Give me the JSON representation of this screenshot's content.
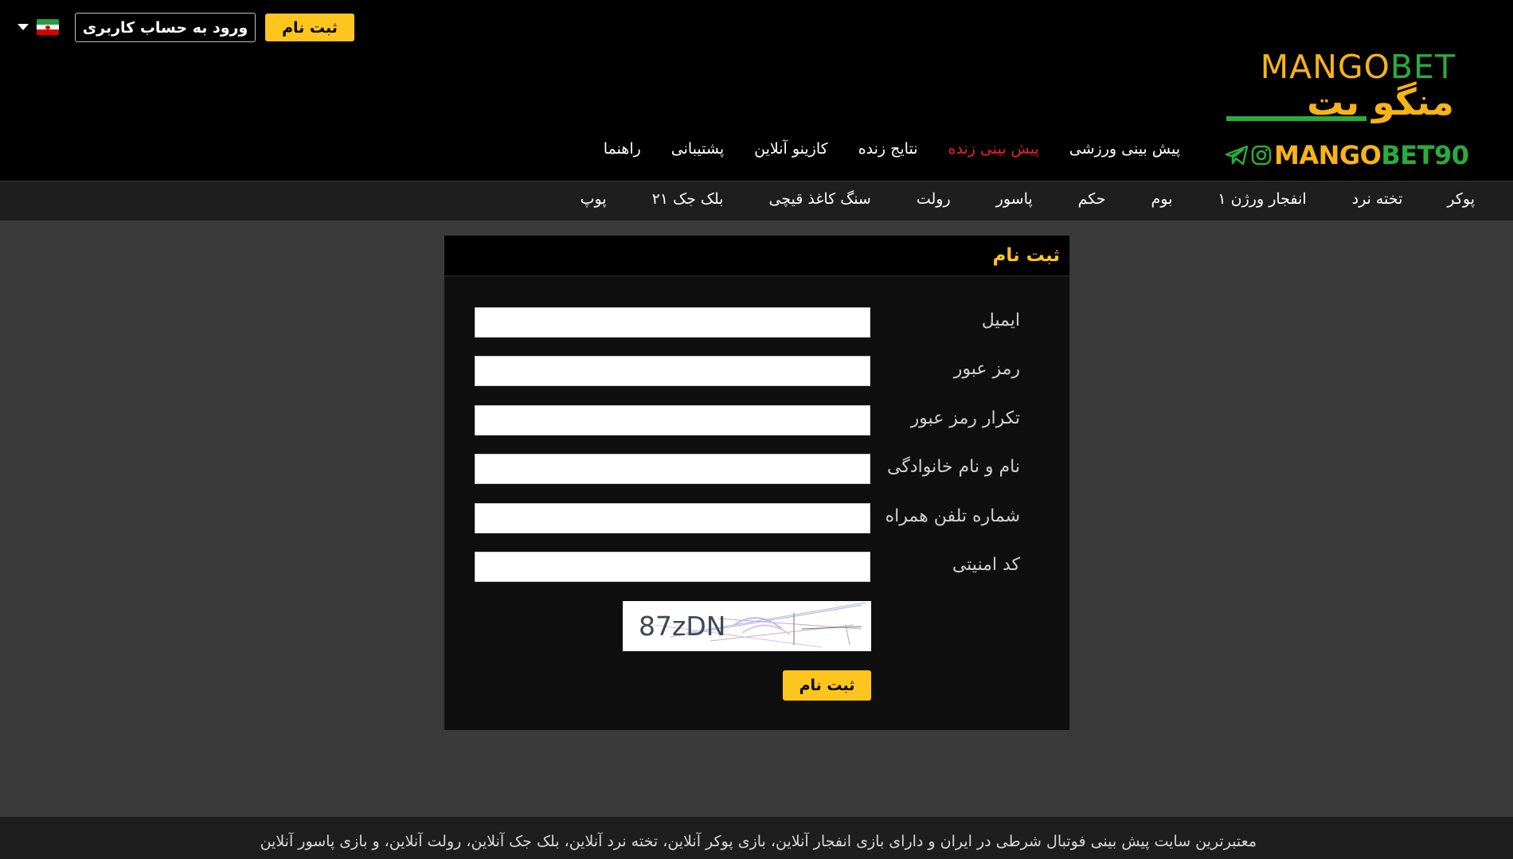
{
  "header": {
    "register_label": "ثبت نام",
    "login_label": "ورود به حساب کاربری",
    "language_flag": "iran-flag-icon",
    "logo": {
      "en_part1": "MANGO",
      "en_part2": "BET",
      "fa": "منگو بت",
      "handle_part1": "MANGO",
      "handle_part2": "BET90"
    }
  },
  "main_nav": {
    "items": [
      {
        "label": "پیش بینی ورزشی",
        "active": false
      },
      {
        "label": "پیش بینی زنده",
        "active": true
      },
      {
        "label": "نتایج زنده",
        "active": false
      },
      {
        "label": "کازینو آنلاین",
        "active": false
      },
      {
        "label": "پشتیبانی",
        "active": false
      },
      {
        "label": "راهنما",
        "active": false
      }
    ]
  },
  "sub_nav": {
    "items": [
      "پوکر",
      "تخته نرد",
      "انفجار ورژن ۱",
      "بوم",
      "حکم",
      "پاسور",
      "رولت",
      "سنگ کاغذ قیچی",
      "بلک جک ۲۱",
      "پوپ"
    ]
  },
  "form": {
    "title": "ثبت نام",
    "fields": [
      {
        "label": "ایمیل",
        "value": ""
      },
      {
        "label": "رمز عبور",
        "value": ""
      },
      {
        "label": "تکرار رمز عبور",
        "value": ""
      },
      {
        "label": "نام و نام خانوادگی",
        "value": ""
      },
      {
        "label": "شماره تلفن همراه",
        "value": ""
      },
      {
        "label": "کد امنیتی",
        "value": ""
      }
    ],
    "captcha_text": "87zDN",
    "submit_label": "ثبت نام"
  },
  "footer": {
    "text": "معتبرترین سایت پیش بینی فوتبال شرطی در ایران و دارای بازی انفجار آنلاین، بازی پوکر آنلاین، تخته نرد آنلاین، بلک جک آنلاین، رولت آنلاین، و بازی پاسور آنلاین"
  },
  "colors": {
    "accent_yellow": "#fdc51d",
    "active_red": "#e8202a",
    "logo_orange": "#f7b318",
    "logo_green": "#2cab3d"
  }
}
